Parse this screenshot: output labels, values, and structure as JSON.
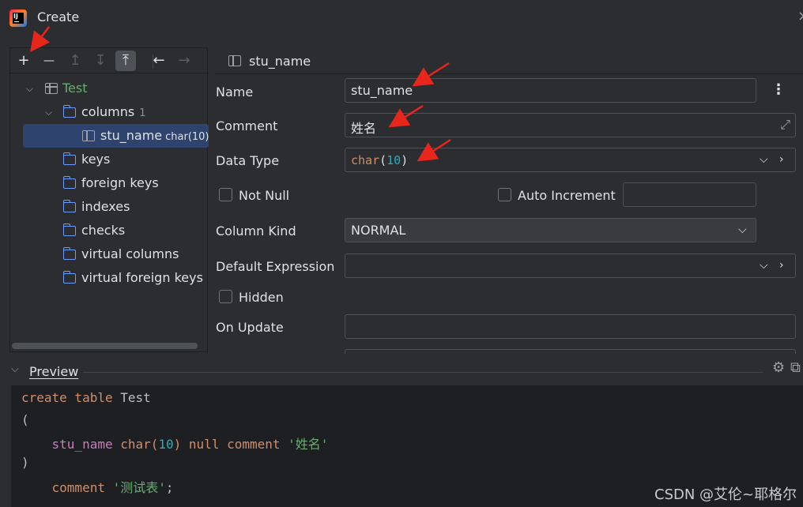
{
  "window": {
    "title": "Create"
  },
  "toolbar": {
    "add": "+",
    "remove": "—",
    "move_up": "↥",
    "move_down": "↧",
    "collapse": "⤒",
    "back": "←",
    "forward": "→"
  },
  "tree": {
    "table": "Test",
    "columns_label": "columns",
    "columns_count": "1",
    "column_name": "stu_name",
    "column_type": "char(10)",
    "folders": [
      "keys",
      "foreign keys",
      "indexes",
      "checks",
      "virtual columns",
      "virtual foreign keys"
    ]
  },
  "header": {
    "title": "stu_name"
  },
  "form": {
    "name_label": "Name",
    "name_value": "stu_name",
    "comment_label": "Comment",
    "comment_value": "姓名",
    "datatype_label": "Data Type",
    "datatype_kw": "char",
    "datatype_open": "(",
    "datatype_num": "10",
    "datatype_close": ")",
    "notnull_label": "Not Null",
    "autoinc_label": "Auto Increment",
    "columnkind_label": "Column Kind",
    "columnkind_value": "NORMAL",
    "default_label": "Default Expression",
    "hidden_label": "Hidden",
    "onupdate_label": "On Update"
  },
  "preview": {
    "label": "Preview",
    "code": {
      "l1_kw": "create table",
      "l1_name": " Test",
      "l2": "(",
      "l3_field": "stu_name",
      "l3_type": " char(",
      "l3_num": "10",
      "l3_rest": ") null comment ",
      "l3_str": "'姓名'",
      "l4": ")",
      "l5_kw": "comment",
      "l5_str": "'测试表'",
      "l5_end": ";"
    }
  },
  "watermark": "CSDN @艾伦~耶格尔",
  "colors": {
    "accent_selected": "#2e436e",
    "keyword": "#cf8e6d",
    "number": "#2aacb8",
    "string": "#6aab73",
    "arrow": "#e8261c"
  }
}
